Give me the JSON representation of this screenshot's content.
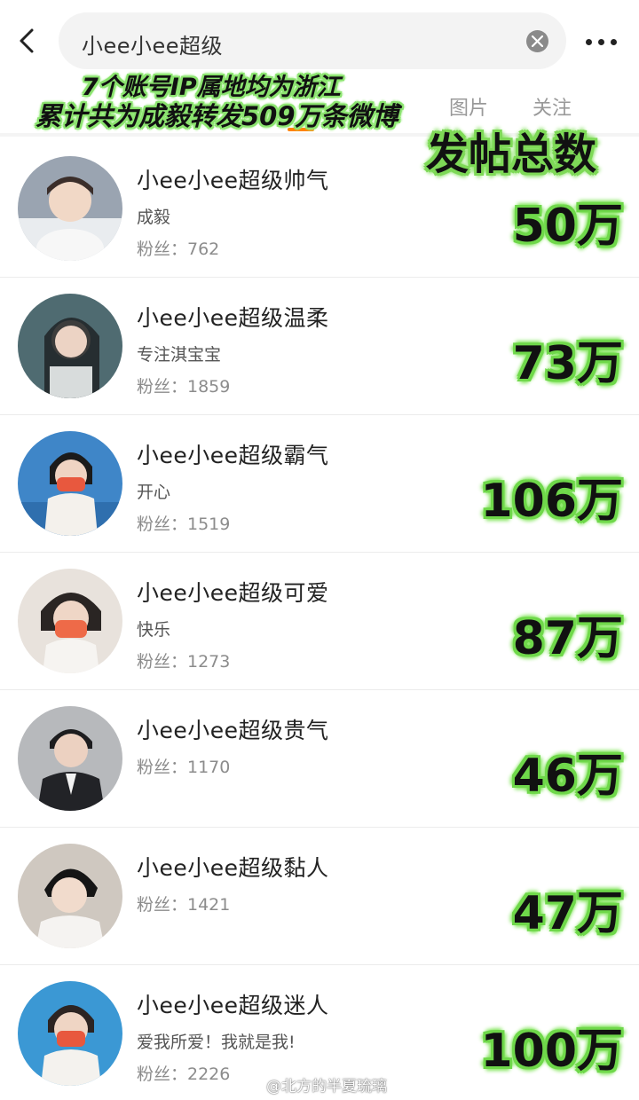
{
  "search": {
    "query": "小ee小ee超级"
  },
  "tabs": [
    "图片",
    "关注"
  ],
  "annotation": {
    "line1": "7个账号IP属地均为浙江",
    "line2": "累计共为成毅转发509万条微博",
    "header": "发帖总数"
  },
  "fans_label": "粉丝：",
  "users": [
    {
      "name": "小ee小ee超级帅气",
      "bio": "成毅",
      "fans": "粉丝：762",
      "posts": "50万"
    },
    {
      "name": "小ee小ee超级温柔",
      "bio": "专注淇宝宝",
      "fans": "粉丝：1859",
      "posts": "73万"
    },
    {
      "name": "小ee小ee超级霸气",
      "bio": "开心",
      "fans": "粉丝：1519",
      "posts": "106万"
    },
    {
      "name": "小ee小ee超级可爱",
      "bio": "快乐",
      "fans": "粉丝：1273",
      "posts": "87万"
    },
    {
      "name": "小ee小ee超级贵气",
      "bio": "",
      "fans": "粉丝：1170",
      "posts": "46万"
    },
    {
      "name": "小ee小ee超级黏人",
      "bio": "",
      "fans": "粉丝：1421",
      "posts": "47万"
    },
    {
      "name": "小ee小ee超级迷人",
      "bio": "爱我所爱！我就是我!",
      "fans": "粉丝：2226",
      "posts": "100万"
    }
  ],
  "watermark": "@北方的半夏琉璃",
  "colors": {
    "highlight": "#7ed957",
    "tab_accent": "#ff8200"
  }
}
